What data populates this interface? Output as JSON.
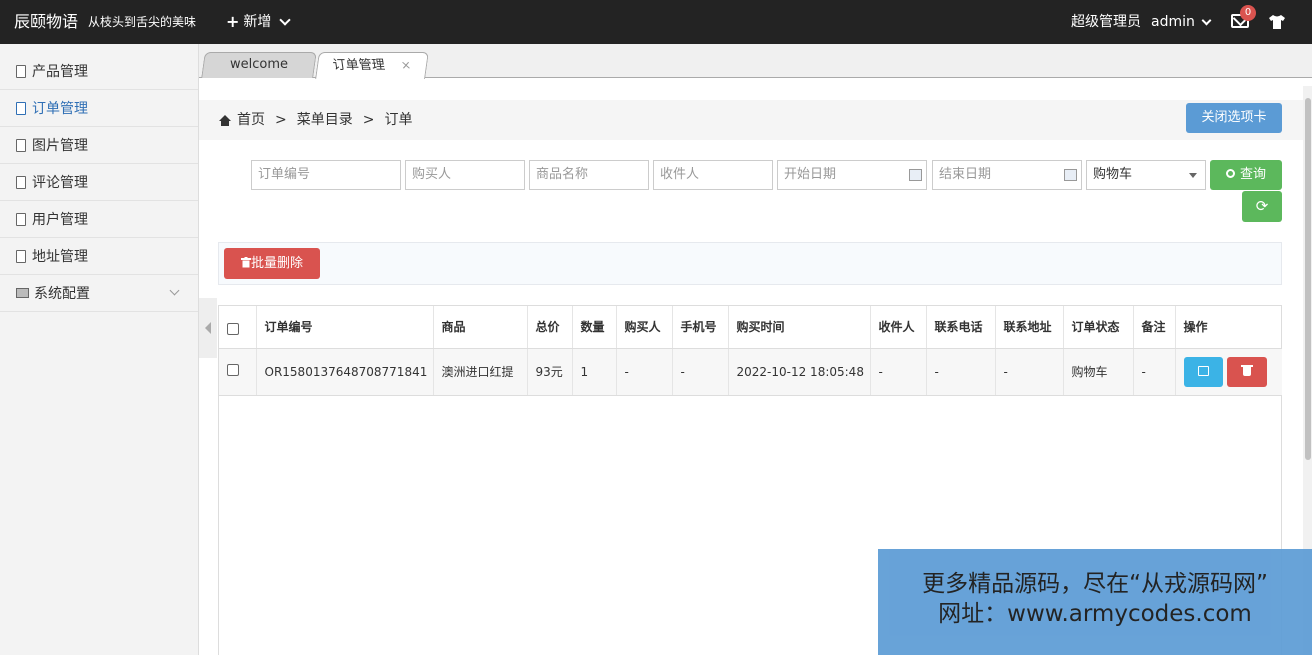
{
  "topbar": {
    "brand": "辰颐物语",
    "slogan": "从枝头到舌尖的美味",
    "new_label": "新增",
    "role": "超级管理员",
    "user": "admin",
    "mail_count": "0"
  },
  "sidebar": {
    "items": [
      {
        "label": "产品管理"
      },
      {
        "label": "订单管理"
      },
      {
        "label": "图片管理"
      },
      {
        "label": "评论管理"
      },
      {
        "label": "用户管理"
      },
      {
        "label": "地址管理"
      },
      {
        "label": "系统配置"
      }
    ]
  },
  "tabs": {
    "welcome": "welcome",
    "order": "订单管理",
    "close_glyph": "×"
  },
  "breadcrumb": {
    "home": "首页",
    "sep": ">",
    "menu": "菜单目录",
    "current": "订单"
  },
  "close_tab_button": "关闭选项卡",
  "filters": {
    "order_no": "订单编号",
    "buyer": "购买人",
    "product": "商品名称",
    "receiver": "收件人",
    "start_date": "开始日期",
    "end_date": "结束日期",
    "status_selected": "购物车",
    "query_button": "查询",
    "refresh_glyph": "⟳"
  },
  "toolbar": {
    "bulk_delete": "批量删除"
  },
  "table": {
    "headers": [
      "订单编号",
      "商品",
      "总价",
      "数量",
      "购买人",
      "手机号",
      "购买时间",
      "收件人",
      "联系电话",
      "联系地址",
      "订单状态",
      "备注",
      "操作"
    ],
    "rows": [
      [
        "OR1580137648708771841",
        "澳洲进口红提",
        "93元",
        "1",
        "-",
        "-",
        "2022-10-12 18:05:48",
        "-",
        "-",
        "-",
        "购物车",
        "-"
      ]
    ]
  },
  "watermark": {
    "line1": "更多精品源码，尽在“从戎源码网”",
    "line2": "网址：www.armycodes.com"
  },
  "colors": {
    "topbar": "#232323",
    "primary": "#5b9bd5",
    "success": "#5cb85c",
    "danger": "#d9534f",
    "info": "#3bb3e6"
  }
}
